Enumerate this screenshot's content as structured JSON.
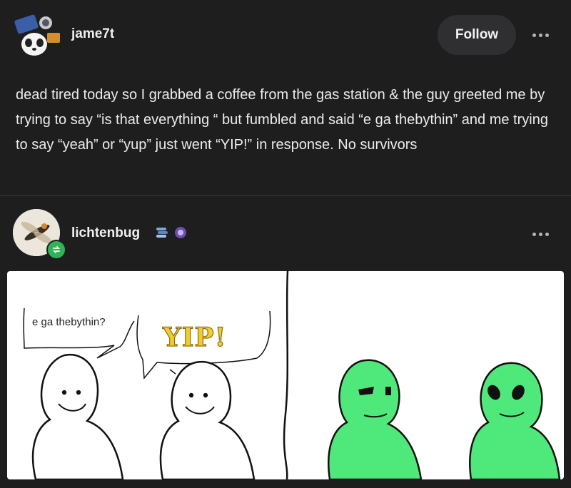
{
  "post": {
    "author": "jame7t",
    "follow_label": "Follow",
    "text": "dead tired today so I grabbed a coffee from the gas station & the guy greeted me by trying to say “is that everything “ but fumbled and said “e ga thebythin” and me trying to say “yeah” or “yup” just went “YIP!” in response. No survivors"
  },
  "reblog": {
    "author": "lichtenbug",
    "comic": {
      "speech_1": "e ga thebythin?",
      "speech_2": "YIP!"
    }
  },
  "colors": {
    "background": "#1e1e1f",
    "alien_green": "#4fe87a",
    "reblog_green": "#2fb357",
    "yip_yellow": "#f3cd2b"
  },
  "icons": [
    "more-options-icon",
    "reblog-icon",
    "badge-icons"
  ]
}
